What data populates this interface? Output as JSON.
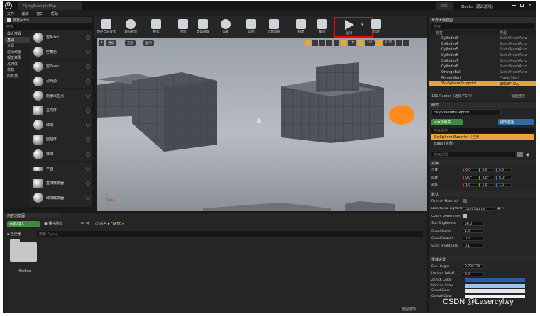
{
  "window": {
    "project_tab": "FlyingExampleMap",
    "doc_tab": "DOC",
    "title": "Blocks [调试游戏]"
  },
  "menu": [
    "文件",
    "编辑",
    "窗口",
    "帮助"
  ],
  "modes": {
    "header": "放置Actor",
    "search_placeholder": "搜索",
    "categories": [
      "最近放置",
      "基础",
      "光源",
      "过场动画",
      "视觉效果",
      "几何体",
      "体积",
      "所有类"
    ],
    "selected": 1
  },
  "primitives": [
    "空Actor",
    "空角色",
    "空Pawn",
    "点光源",
    "玩家出生点",
    "立方体",
    "球体",
    "圆柱体",
    "椎体",
    "平面",
    "盒体触发器",
    "球体触发器"
  ],
  "toolbar": [
    {
      "label": "保存当前关卡",
      "icon": "save-icon"
    },
    {
      "label": "源码管理",
      "icon": "source-control-icon"
    },
    {
      "label": "模式",
      "icon": "modes-icon"
    },
    {
      "label": "内容",
      "icon": "content-icon"
    },
    {
      "label": "虚幻商城",
      "icon": "marketplace-icon"
    },
    {
      "label": "设置",
      "icon": "settings-icon"
    },
    {
      "label": "蓝图",
      "icon": "blueprint-icon"
    },
    {
      "label": "过场动画",
      "icon": "cinematics-icon"
    },
    {
      "label": "构建",
      "icon": "build-icon"
    },
    {
      "label": "编译",
      "icon": "compile-icon"
    },
    {
      "label": "运行",
      "icon": "play-icon"
    },
    {
      "label": "启动",
      "icon": "launch-icon"
    }
  ],
  "viewport": {
    "perspective": "透视",
    "lit": "光照",
    "show": "显示",
    "snap_grid": "10",
    "snap_angle": "10°",
    "snap_scale": "0.25"
  },
  "outliner": {
    "header": "世界大纲视图",
    "search_placeholder": "搜索",
    "col_label": "标签",
    "col_type": "类型",
    "rows": [
      {
        "label": "Cylinder3",
        "type": "StaticMeshActo"
      },
      {
        "label": "Cylinder4",
        "type": "StaticMeshActo"
      },
      {
        "label": "Cylinder5",
        "type": "StaticMeshActo"
      },
      {
        "label": "Cylinder6",
        "type": "StaticMeshActo"
      },
      {
        "label": "Cylinder7",
        "type": "StaticMeshActo"
      },
      {
        "label": "Cylinder8",
        "type": "StaticMeshActo"
      },
      {
        "label": "OrangeBall",
        "type": "StaticMeshActo"
      },
      {
        "label": "PlayerStart",
        "type": "PlayerStart"
      },
      {
        "label": "SkySphereBlueprint",
        "type": "编辑BP_Sky_"
      }
    ],
    "selected": 8,
    "status": "181个actor（选择了1个）",
    "view_options": "视图选项"
  },
  "details": {
    "header": "细节",
    "actor_name": "SkySphereBlueprint",
    "add_component": "+添加组件",
    "edit_blueprint": "编辑蓝图",
    "search_components": "搜索组件",
    "self_item": "SkySphereBlueprint（自身）",
    "base_item": "Base (继承)",
    "search_details": "搜索详情",
    "transform_section": "变换",
    "transform": [
      {
        "label": "位置",
        "vals": [
          "0.0",
          "0.0",
          "0.0"
        ]
      },
      {
        "label": "旋转",
        "vals": [
          "0.0°",
          "0.0°",
          "0.0°"
        ]
      },
      {
        "label": "缩放",
        "vals": [
          "1.0",
          "1.0",
          "1.0"
        ]
      }
    ],
    "default_section": "默认",
    "props": [
      {
        "label": "Refresh Material",
        "value": ""
      },
      {
        "label": "Directional Light Act",
        "value": "Light Source"
      },
      {
        "label": "Colors Determined B",
        "value": ""
      },
      {
        "label": "Sun Brightness",
        "value": "50.0"
      },
      {
        "label": "Cloud Speed",
        "value": "1.0"
      },
      {
        "label": "Cloud Opacity",
        "value": "0.7"
      },
      {
        "label": "Stars Brightness",
        "value": "0.1"
      }
    ],
    "override_section": "重载设置",
    "overrides": [
      {
        "label": "Sun Height",
        "value": "0.736771"
      },
      {
        "label": "Horizon Falloff",
        "value": "3.0"
      },
      {
        "label": "Zenith Color",
        "value": ""
      },
      {
        "label": "Horizon Color",
        "value": ""
      },
      {
        "label": "Cloud Color",
        "value": ""
      },
      {
        "label": "Overall Color",
        "value": ""
      }
    ]
  },
  "content_browser": {
    "header": "内容浏览器",
    "import_button": "添加/导入",
    "save_all": "保存所有",
    "path_root": "内容",
    "path_folder": "Flying",
    "filters": "过滤器",
    "search_placeholder": "搜索 Flying",
    "folder_name": "Meshes",
    "view_options": "视图选项"
  },
  "watermark": "CSDN @Lasercylwy",
  "colors": {
    "accent_blue": "#2f6aa6",
    "play_highlight": "#ff0000",
    "panel_bg": "#252525",
    "orange_ball": "#ff8a1e"
  }
}
